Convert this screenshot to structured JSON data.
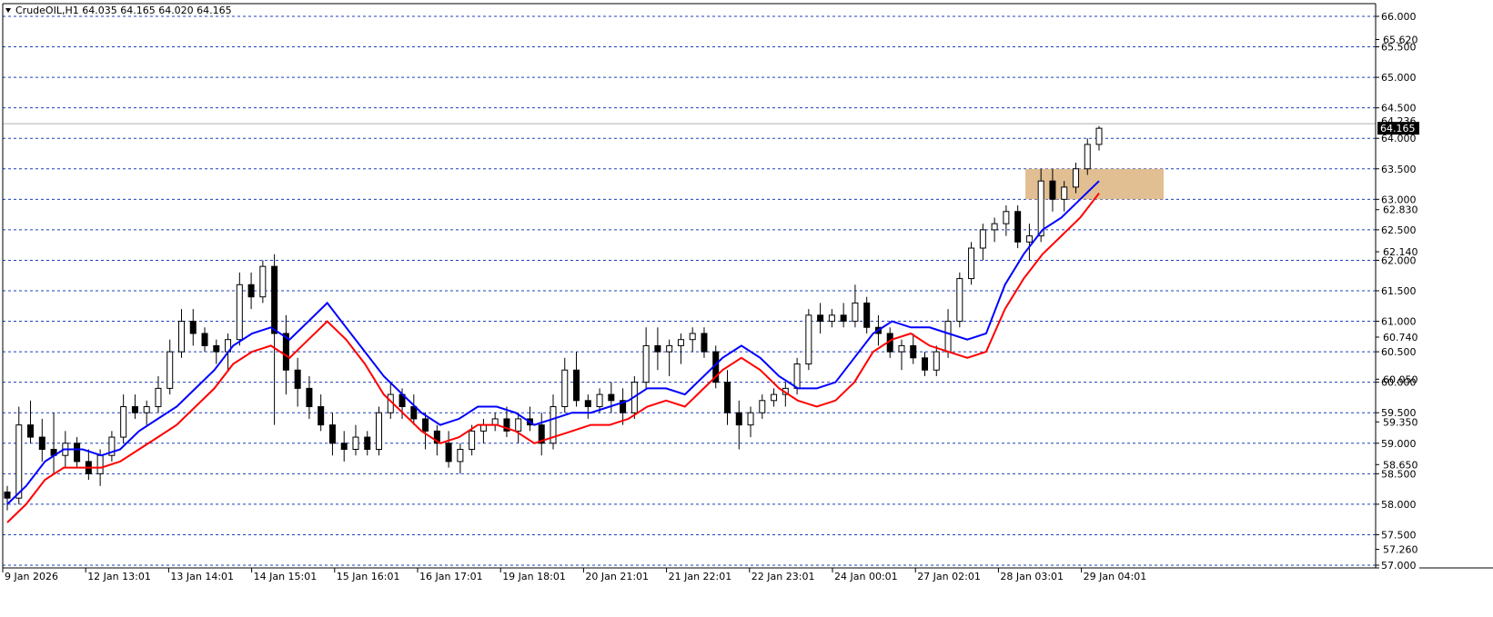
{
  "window": {
    "header": "CrudeOIL,H1  64.035 64.165 64.020 64.165",
    "menu_icon": "triangle-down-icon"
  },
  "chart_data": {
    "type": "candlestick",
    "symbol": "CrudeOIL",
    "timeframe": "H1",
    "ohlc_last": {
      "open": 64.035,
      "high": 64.165,
      "low": 64.02,
      "close": 64.165
    },
    "ylim": [
      57.0,
      66.0
    ],
    "y_ticks": [
      "66.000",
      "65.500",
      "65.000",
      "64.500",
      "64.000",
      "63.500",
      "63.000",
      "62.500",
      "62.000",
      "61.500",
      "61.000",
      "60.500",
      "60.000",
      "59.500",
      "59.000",
      "58.500",
      "58.000",
      "57.500",
      "57.000"
    ],
    "y_ticks_extra": [
      "65.620",
      "62.830",
      "62.140",
      "60.740",
      "60.050",
      "59.350",
      "58.650",
      "57.260"
    ],
    "current_price": "64.165",
    "current_price_behind": "64.236",
    "x_ticks": [
      "9 Jan 2026",
      "12 Jan 13:01",
      "13 Jan 14:01",
      "14 Jan 15:01",
      "15 Jan 16:01",
      "16 Jan 17:01",
      "19 Jan 18:01",
      "20 Jan 21:01",
      "21 Jan 22:01",
      "22 Jan 23:01",
      "24 Jan 00:01",
      "27 Jan 02:01",
      "28 Jan 03:01",
      "29 Jan 04:01"
    ],
    "grid": "horizontal-dashed",
    "series": [
      {
        "kind": "ma",
        "color": "#0000ff",
        "values": [
          58.0,
          58.3,
          58.7,
          58.9,
          58.9,
          58.8,
          58.9,
          59.2,
          59.4,
          59.6,
          59.9,
          60.2,
          60.6,
          60.8,
          60.9,
          60.7,
          61.0,
          61.3,
          60.9,
          60.5,
          60.1,
          59.8,
          59.5,
          59.3,
          59.4,
          59.6,
          59.6,
          59.5,
          59.3,
          59.4,
          59.5,
          59.5,
          59.6,
          59.7,
          59.9,
          59.9,
          59.8,
          60.1,
          60.4,
          60.6,
          60.4,
          60.1,
          59.9,
          59.9,
          60.0,
          60.4,
          60.8,
          61.0,
          60.9,
          60.9,
          60.8,
          60.7,
          60.8,
          61.6,
          62.1,
          62.5,
          62.7,
          63.0,
          63.3
        ],
        "color_name": "blue"
      },
      {
        "kind": "ma",
        "color": "#ff0000",
        "values": [
          57.7,
          58.0,
          58.4,
          58.6,
          58.6,
          58.6,
          58.7,
          58.9,
          59.1,
          59.3,
          59.6,
          59.9,
          60.3,
          60.5,
          60.6,
          60.4,
          60.7,
          61.0,
          60.7,
          60.3,
          59.8,
          59.5,
          59.2,
          59.0,
          59.1,
          59.3,
          59.3,
          59.2,
          59.0,
          59.1,
          59.2,
          59.3,
          59.3,
          59.4,
          59.6,
          59.7,
          59.6,
          59.9,
          60.2,
          60.4,
          60.2,
          59.9,
          59.7,
          59.6,
          59.7,
          60.0,
          60.5,
          60.7,
          60.8,
          60.6,
          60.5,
          60.4,
          60.5,
          61.2,
          61.7,
          62.1,
          62.4,
          62.7,
          63.1
        ],
        "color_name": "red"
      }
    ],
    "candles": [
      [
        58.2,
        58.3,
        57.9,
        58.1
      ],
      [
        58.1,
        59.6,
        58.0,
        59.3
      ],
      [
        59.3,
        59.7,
        59.0,
        59.1
      ],
      [
        59.1,
        59.4,
        58.7,
        58.9
      ],
      [
        58.9,
        59.5,
        58.5,
        58.8
      ],
      [
        58.8,
        59.2,
        58.6,
        59.0
      ],
      [
        59.0,
        59.1,
        58.6,
        58.7
      ],
      [
        58.7,
        58.9,
        58.4,
        58.5
      ],
      [
        58.5,
        58.9,
        58.3,
        58.8
      ],
      [
        58.8,
        59.2,
        58.7,
        59.1
      ],
      [
        59.1,
        59.8,
        59.0,
        59.6
      ],
      [
        59.6,
        59.8,
        59.4,
        59.5
      ],
      [
        59.5,
        59.7,
        59.3,
        59.6
      ],
      [
        59.6,
        60.1,
        59.5,
        59.9
      ],
      [
        59.9,
        60.7,
        59.8,
        60.5
      ],
      [
        60.5,
        61.2,
        60.4,
        61.0
      ],
      [
        61.0,
        61.2,
        60.6,
        60.8
      ],
      [
        60.8,
        60.9,
        60.5,
        60.6
      ],
      [
        60.6,
        60.7,
        60.3,
        60.5
      ],
      [
        60.5,
        60.8,
        60.2,
        60.7
      ],
      [
        60.7,
        61.8,
        60.6,
        61.6
      ],
      [
        61.6,
        61.8,
        61.2,
        61.4
      ],
      [
        61.4,
        62.0,
        61.3,
        61.9
      ],
      [
        61.9,
        62.1,
        59.3,
        60.8
      ],
      [
        60.8,
        61.1,
        59.8,
        60.2
      ],
      [
        60.2,
        60.4,
        59.6,
        59.9
      ],
      [
        59.9,
        60.1,
        59.4,
        59.6
      ],
      [
        59.6,
        59.8,
        59.2,
        59.3
      ],
      [
        59.3,
        59.5,
        58.8,
        59.0
      ],
      [
        59.0,
        59.2,
        58.7,
        58.9
      ],
      [
        58.9,
        59.3,
        58.8,
        59.1
      ],
      [
        59.1,
        59.2,
        58.8,
        58.9
      ],
      [
        58.9,
        59.6,
        58.8,
        59.5
      ],
      [
        59.5,
        60.0,
        59.4,
        59.8
      ],
      [
        59.8,
        59.9,
        59.4,
        59.6
      ],
      [
        59.6,
        59.8,
        59.3,
        59.4
      ],
      [
        59.4,
        59.5,
        58.9,
        59.2
      ],
      [
        59.2,
        59.3,
        58.8,
        59.0
      ],
      [
        59.0,
        59.2,
        58.6,
        58.7
      ],
      [
        58.7,
        59.0,
        58.5,
        58.9
      ],
      [
        58.9,
        59.3,
        58.8,
        59.2
      ],
      [
        59.2,
        59.4,
        59.0,
        59.3
      ],
      [
        59.3,
        59.5,
        59.2,
        59.4
      ],
      [
        59.4,
        59.6,
        59.1,
        59.2
      ],
      [
        59.2,
        59.5,
        59.0,
        59.4
      ],
      [
        59.4,
        59.6,
        59.2,
        59.3
      ],
      [
        59.3,
        59.5,
        58.8,
        59.0
      ],
      [
        59.0,
        59.8,
        58.9,
        59.6
      ],
      [
        59.6,
        60.4,
        59.5,
        60.2
      ],
      [
        60.2,
        60.5,
        59.6,
        59.7
      ],
      [
        59.7,
        59.8,
        59.4,
        59.6
      ],
      [
        59.6,
        59.9,
        59.5,
        59.8
      ],
      [
        59.8,
        60.0,
        59.5,
        59.7
      ],
      [
        59.7,
        59.9,
        59.3,
        59.5
      ],
      [
        59.5,
        60.1,
        59.4,
        60.0
      ],
      [
        60.0,
        60.9,
        59.9,
        60.6
      ],
      [
        60.6,
        60.9,
        60.2,
        60.5
      ],
      [
        60.5,
        60.7,
        60.1,
        60.6
      ],
      [
        60.6,
        60.8,
        60.3,
        60.7
      ],
      [
        60.7,
        60.9,
        60.5,
        60.8
      ],
      [
        60.8,
        60.9,
        60.4,
        60.5
      ],
      [
        60.5,
        60.6,
        59.9,
        60.0
      ],
      [
        60.0,
        60.2,
        59.3,
        59.5
      ],
      [
        59.5,
        59.7,
        58.9,
        59.3
      ],
      [
        59.3,
        59.6,
        59.1,
        59.5
      ],
      [
        59.5,
        59.8,
        59.4,
        59.7
      ],
      [
        59.7,
        59.9,
        59.6,
        59.8
      ],
      [
        59.8,
        60.0,
        59.6,
        59.9
      ],
      [
        59.9,
        60.4,
        59.8,
        60.3
      ],
      [
        60.3,
        61.2,
        60.2,
        61.1
      ],
      [
        61.1,
        61.3,
        60.8,
        61.0
      ],
      [
        61.0,
        61.2,
        60.9,
        61.1
      ],
      [
        61.1,
        61.3,
        60.9,
        61.0
      ],
      [
        61.0,
        61.6,
        60.9,
        61.3
      ],
      [
        61.3,
        61.4,
        60.8,
        60.9
      ],
      [
        60.9,
        61.1,
        60.6,
        60.8
      ],
      [
        60.8,
        60.9,
        60.4,
        60.5
      ],
      [
        60.5,
        60.7,
        60.2,
        60.6
      ],
      [
        60.6,
        60.8,
        60.3,
        60.4
      ],
      [
        60.4,
        60.5,
        60.1,
        60.2
      ],
      [
        60.2,
        60.6,
        60.1,
        60.5
      ],
      [
        60.5,
        61.2,
        60.4,
        61.0
      ],
      [
        61.0,
        61.8,
        60.9,
        61.7
      ],
      [
        61.7,
        62.3,
        61.6,
        62.2
      ],
      [
        62.2,
        62.6,
        62.0,
        62.5
      ],
      [
        62.5,
        62.7,
        62.3,
        62.6
      ],
      [
        62.6,
        62.9,
        62.4,
        62.8
      ],
      [
        62.8,
        62.9,
        62.2,
        62.3
      ],
      [
        62.3,
        62.6,
        62.0,
        62.4
      ],
      [
        62.4,
        63.5,
        62.3,
        63.3
      ],
      [
        63.3,
        63.5,
        62.8,
        63.0
      ],
      [
        63.0,
        63.3,
        62.8,
        63.2
      ],
      [
        63.2,
        63.6,
        63.1,
        63.5
      ],
      [
        63.5,
        64.0,
        63.4,
        63.9
      ],
      [
        63.9,
        64.2,
        63.8,
        64.165
      ]
    ],
    "zone": {
      "y_low": 63.0,
      "y_high": 63.5,
      "color": "#deb887"
    }
  }
}
